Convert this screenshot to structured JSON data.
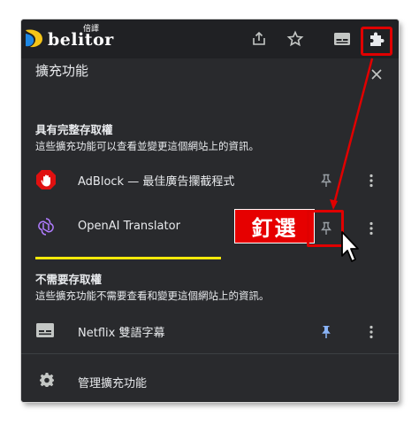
{
  "toolbar": {
    "logo_text": "belitor",
    "logo_sub": "倍譯",
    "icons": [
      "share-icon",
      "star-icon",
      "sidepanel-icon",
      "puzzle-icon"
    ]
  },
  "panel": {
    "title": "擴充功能",
    "close_icon": "close-icon",
    "full_access": {
      "heading": "具有完整存取權",
      "description": "這些擴充功能可以查看並變更這個網站上的資訊。",
      "items": [
        {
          "name": "AdBlock — 最佳廣告攔截程式",
          "icon": "adblock-hand-icon",
          "pinned": false
        },
        {
          "name": "OpenAI Translator",
          "icon": "openai-knot-icon",
          "pinned": false
        }
      ]
    },
    "no_access": {
      "heading": "不需要存取權",
      "description": "這些擴充功能不需要查看和變更這個網站上的資訊。",
      "items": [
        {
          "name": "Netflix 雙語字幕",
          "icon": "subtitle-icon",
          "pinned": true
        }
      ]
    },
    "manage_label": "管理擴充功能"
  },
  "annotation": {
    "callout_text": "釘選"
  },
  "colors": {
    "panel_bg": "#292a2d",
    "toolbar_bg": "#202124",
    "highlight_red": "#e00000",
    "underline_yellow": "#f6e90a",
    "pin_active_blue": "#8ab4f8"
  }
}
